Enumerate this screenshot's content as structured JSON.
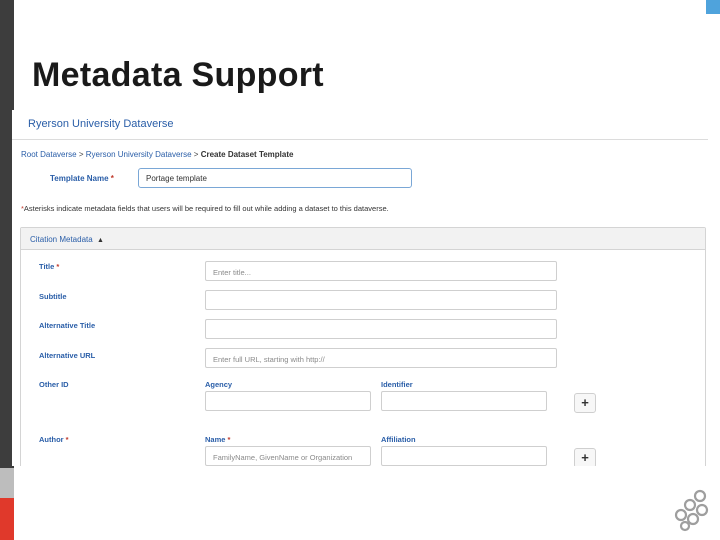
{
  "slide": {
    "title": "Metadata Support"
  },
  "screenshot": {
    "brand": "Ryerson University Dataverse",
    "breadcrumb": {
      "items": [
        "Root Dataverse",
        "Ryerson University Dataverse",
        "Create Dataset Template"
      ],
      "separator": ">"
    },
    "template_name": {
      "label": "Template Name",
      "value": "Portage template"
    },
    "required_asterisk": "*",
    "asterisk_note": "Asterisks indicate metadata fields that users will be required to fill out while adding a dataset to this dataverse.",
    "citation_panel": {
      "title": "Citation Metadata",
      "caret_icon": "caret-up-icon",
      "fields": {
        "title": {
          "label": "Title",
          "placeholder": "Enter title..."
        },
        "subtitle": {
          "label": "Subtitle",
          "placeholder": ""
        },
        "alternative_title": {
          "label": "Alternative Title",
          "placeholder": ""
        },
        "alternative_url": {
          "label": "Alternative URL",
          "placeholder": "Enter full URL, starting with http://"
        },
        "other_id": {
          "label": "Other ID",
          "agency_label": "Agency",
          "identifier_label": "Identifier",
          "add": "+"
        },
        "author": {
          "label": "Author",
          "name_label": "Name",
          "name_placeholder": "FamilyName, GivenName or Organization",
          "affiliation_label": "Affiliation",
          "add": "+"
        }
      }
    }
  },
  "colors": {
    "link": "#2a5ea8",
    "required": "#c0392b",
    "accent_red": "#e0392b",
    "accent_blue": "#4fa3dc"
  }
}
